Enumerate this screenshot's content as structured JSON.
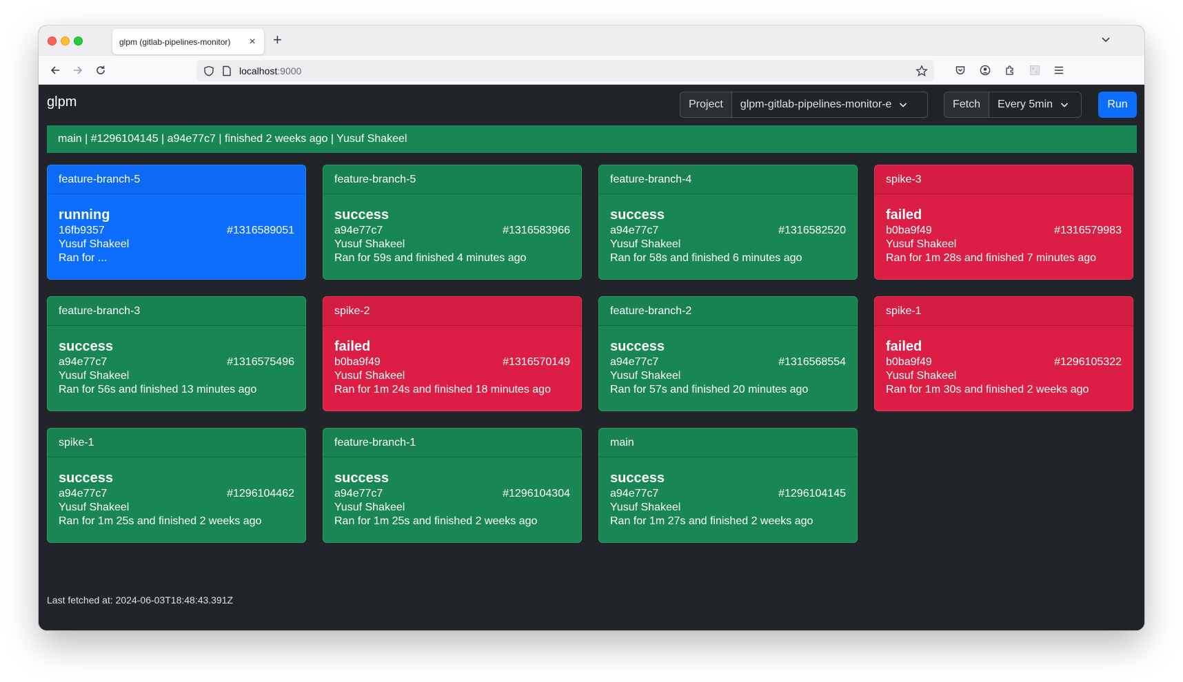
{
  "browser": {
    "tab_title": "glpm (gitlab-pipelines-monitor)",
    "url_host": "localhost",
    "url_port": ":9000"
  },
  "app": {
    "brand": "glpm",
    "project_label": "Project",
    "project_value": "glpm-gitlab-pipelines-monitor-e",
    "fetch_label": "Fetch",
    "fetch_value": "Every 5min",
    "run_label": "Run"
  },
  "main_banner": "main | #1296104145 | a94e77c7 | finished 2 weeks ago | Yusuf Shakeel",
  "cards": [
    {
      "branch": "feature-branch-5",
      "status": "running",
      "sha": "16fb9357",
      "id": "#1316589051",
      "author": "Yusuf Shakeel",
      "summary": "Ran for ..."
    },
    {
      "branch": "feature-branch-5",
      "status": "success",
      "sha": "a94e77c7",
      "id": "#1316583966",
      "author": "Yusuf Shakeel",
      "summary": "Ran for 59s and finished 4 minutes ago"
    },
    {
      "branch": "feature-branch-4",
      "status": "success",
      "sha": "a94e77c7",
      "id": "#1316582520",
      "author": "Yusuf Shakeel",
      "summary": "Ran for 58s and finished 6 minutes ago"
    },
    {
      "branch": "spike-3",
      "status": "failed",
      "sha": "b0ba9f49",
      "id": "#1316579983",
      "author": "Yusuf Shakeel",
      "summary": "Ran for 1m 28s and finished 7 minutes ago"
    },
    {
      "branch": "feature-branch-3",
      "status": "success",
      "sha": "a94e77c7",
      "id": "#1316575496",
      "author": "Yusuf Shakeel",
      "summary": "Ran for 56s and finished 13 minutes ago"
    },
    {
      "branch": "spike-2",
      "status": "failed",
      "sha": "b0ba9f49",
      "id": "#1316570149",
      "author": "Yusuf Shakeel",
      "summary": "Ran for 1m 24s and finished 18 minutes ago"
    },
    {
      "branch": "feature-branch-2",
      "status": "success",
      "sha": "a94e77c7",
      "id": "#1316568554",
      "author": "Yusuf Shakeel",
      "summary": "Ran for 57s and finished 20 minutes ago"
    },
    {
      "branch": "spike-1",
      "status": "failed",
      "sha": "b0ba9f49",
      "id": "#1296105322",
      "author": "Yusuf Shakeel",
      "summary": "Ran for 1m 30s and finished 2 weeks ago"
    },
    {
      "branch": "spike-1",
      "status": "success",
      "sha": "a94e77c7",
      "id": "#1296104462",
      "author": "Yusuf Shakeel",
      "summary": "Ran for 1m 25s and finished 2 weeks ago"
    },
    {
      "branch": "feature-branch-1",
      "status": "success",
      "sha": "a94e77c7",
      "id": "#1296104304",
      "author": "Yusuf Shakeel",
      "summary": "Ran for 1m 25s and finished 2 weeks ago"
    },
    {
      "branch": "main",
      "status": "success",
      "sha": "a94e77c7",
      "id": "#1296104145",
      "author": "Yusuf Shakeel",
      "summary": "Ran for 1m 27s and finished 2 weeks ago"
    }
  ],
  "last_fetched": "Last fetched at: 2024-06-03T18:48:43.391Z",
  "colors": {
    "success": "#198754",
    "failed": "#dc1e44",
    "running": "#0d6efd",
    "background": "#212529"
  }
}
